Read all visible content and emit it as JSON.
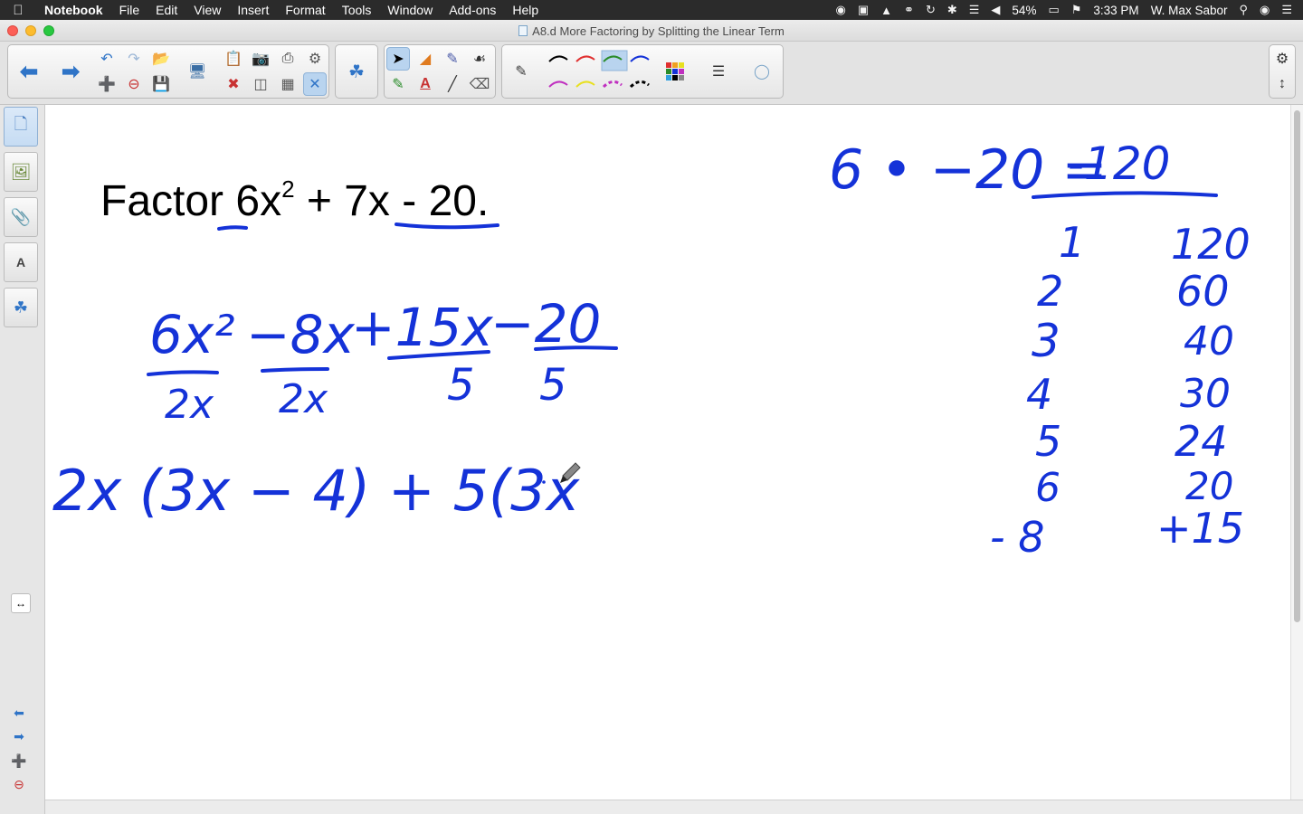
{
  "menubar": {
    "app_name": "Notebook",
    "items": [
      "File",
      "Edit",
      "View",
      "Insert",
      "Format",
      "Tools",
      "Window",
      "Add-ons",
      "Help"
    ],
    "battery": "54%",
    "time": "3:33 PM",
    "user": "W. Max Sabor"
  },
  "window": {
    "title": "A8.d More Factoring by Splitting the Linear Term"
  },
  "toolbar": {
    "back_icon": "back-arrow-icon",
    "forward_icon": "forward-arrow-icon",
    "selected_tool": "select-pointer"
  },
  "page": {
    "title_prefix": "Factor 6x",
    "title_exponent": "2",
    "title_suffix": " + 7x - 20."
  },
  "ink": {
    "product_line": "6 • −20 =",
    "product_result": "-120",
    "split_terms": [
      "6x²",
      "−8x",
      "+15x",
      "−20"
    ],
    "gcf_labels": [
      "2x",
      "2x",
      "5",
      "5"
    ],
    "factored_line": "2x (3x − 4) + 5(3x",
    "factor_pairs_left": [
      "1",
      "2",
      "3",
      "4",
      "5",
      "6",
      "- 8"
    ],
    "factor_pairs_right": [
      "120",
      "60",
      "40",
      "30",
      "24",
      "20",
      "+15"
    ]
  },
  "colors": {
    "ink": "#1432d8",
    "menubar": "#2b2b2b",
    "accent": "#2f74c7"
  }
}
